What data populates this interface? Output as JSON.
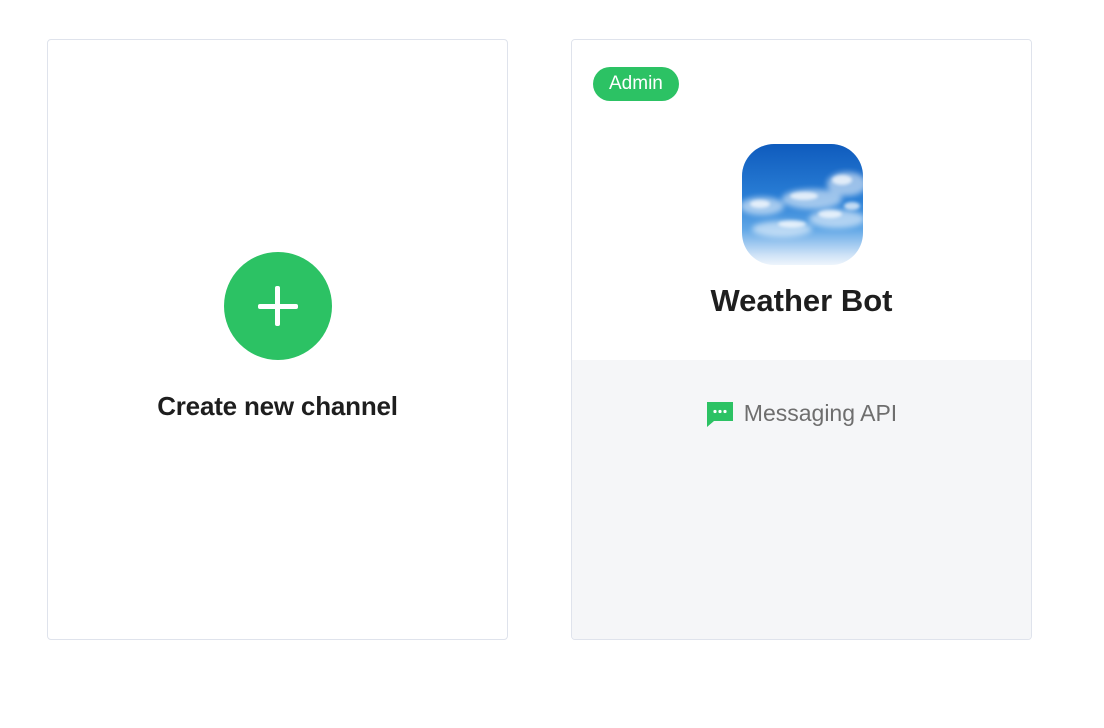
{
  "create_card": {
    "label": "Create new channel",
    "icon": "plus-icon",
    "accent_color": "#2cc264"
  },
  "channel_card": {
    "badge": "Admin",
    "name": "Weather Bot",
    "avatar": "sky-clouds-image",
    "type_icon": "chat-bubble-icon",
    "type_label": "Messaging API",
    "badge_color": "#2cc264"
  }
}
